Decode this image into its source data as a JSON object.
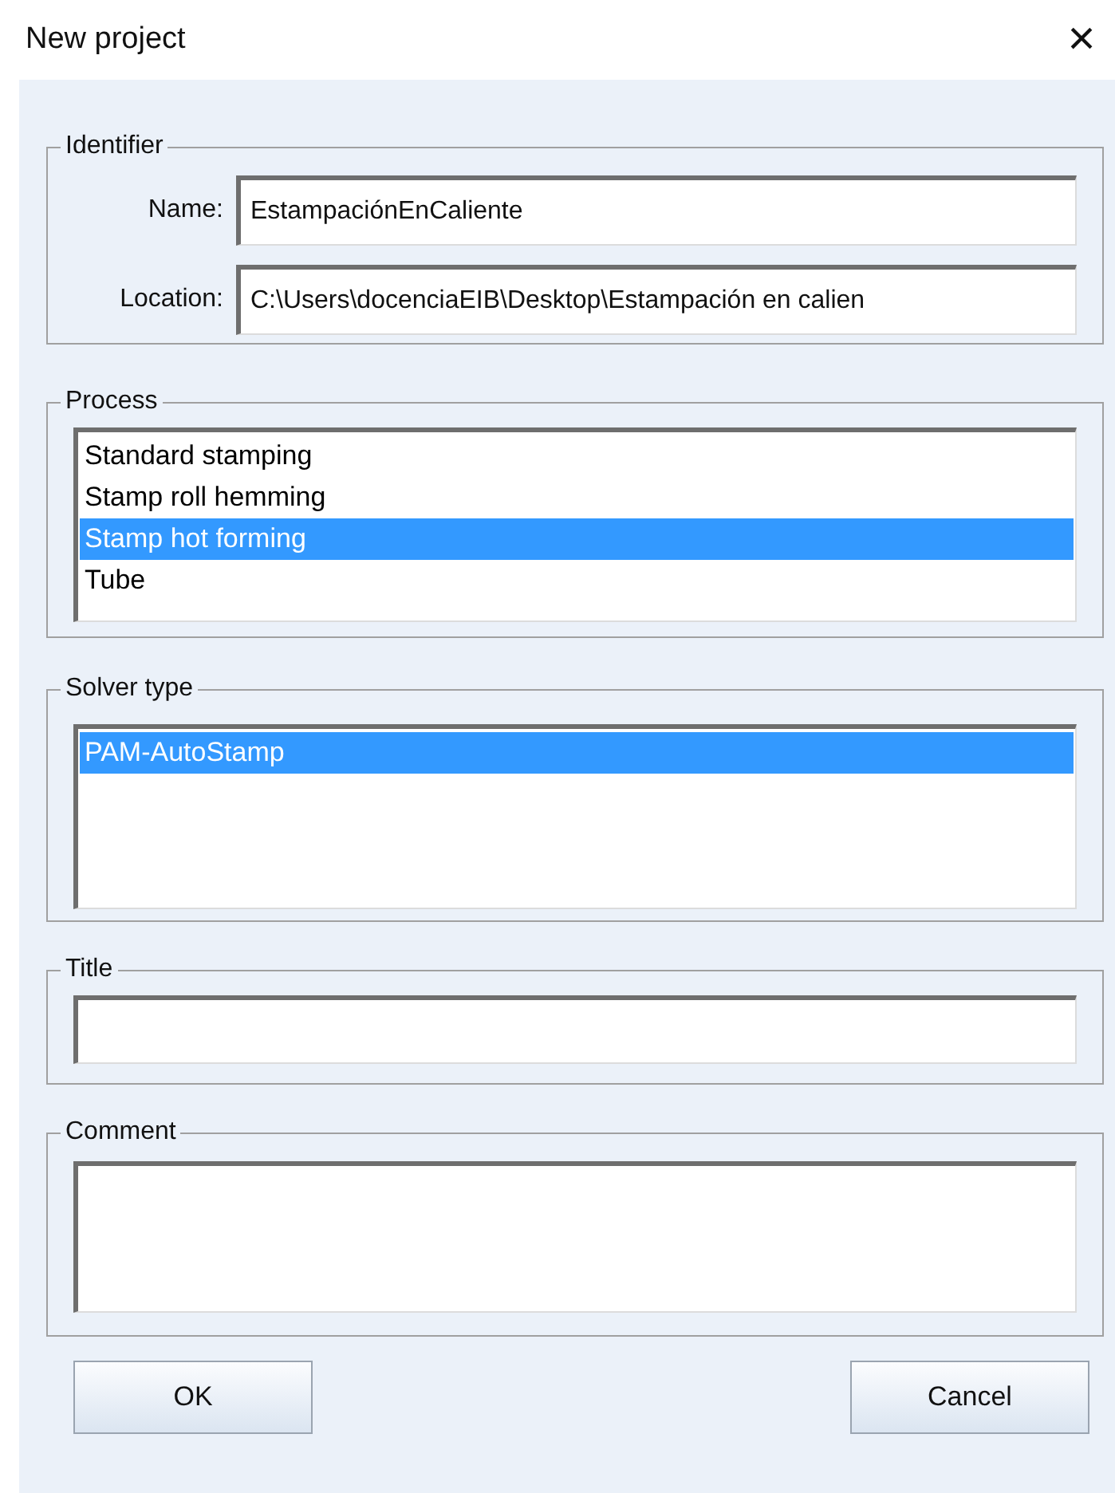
{
  "window": {
    "title": "New project",
    "close": "×"
  },
  "identifier": {
    "legend": "Identifier",
    "fields": [
      {
        "label": "Name:",
        "value": "EstampaciónEnCaliente"
      },
      {
        "label": "Location:",
        "value": "C:\\Users\\docenciaEIB\\Desktop\\Estampación en calien"
      }
    ]
  },
  "process": {
    "legend": "Process",
    "items": [
      {
        "label": "Standard stamping",
        "selected": false
      },
      {
        "label": "Stamp roll hemming",
        "selected": false
      },
      {
        "label": "Stamp hot forming",
        "selected": true
      },
      {
        "label": "Tube",
        "selected": false
      }
    ]
  },
  "solver_type": {
    "legend": "Solver type",
    "items": [
      {
        "label": "PAM-AutoStamp",
        "selected": true
      }
    ]
  },
  "title": {
    "legend": "Title"
  },
  "comment": {
    "legend": "Comment"
  },
  "buttons": [
    "OK",
    "Cancel"
  ]
}
